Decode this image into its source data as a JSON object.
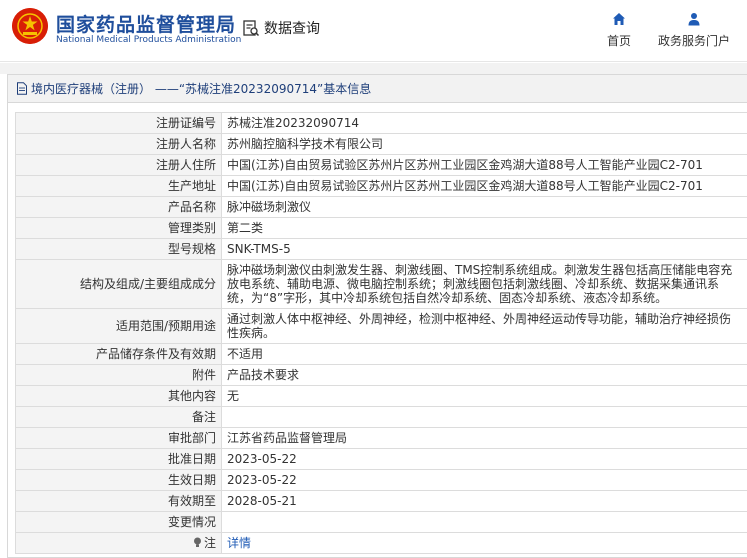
{
  "header": {
    "brand_cn": "国家药品监督管理局",
    "brand_en": "National Medical Products Administration",
    "search_label": "数据查询",
    "nav": [
      {
        "label": "首页",
        "icon": "home-icon"
      },
      {
        "label": "政务服务门户",
        "icon": "user-icon"
      }
    ]
  },
  "panel": {
    "title": "境内医疗器械（注册） ——“苏械注准20232090714”基本信息"
  },
  "rows": [
    {
      "key": "注册证编号",
      "value": "苏械注准20232090714"
    },
    {
      "key": "注册人名称",
      "value": "苏州脑控脑科学技术有限公司"
    },
    {
      "key": "注册人住所",
      "value": "中国(江苏)自由贸易试验区苏州片区苏州工业园区金鸡湖大道88号人工智能产业园C2-701"
    },
    {
      "key": "生产地址",
      "value": "中国(江苏)自由贸易试验区苏州片区苏州工业园区金鸡湖大道88号人工智能产业园C2-701"
    },
    {
      "key": "产品名称",
      "value": "脉冲磁场刺激仪"
    },
    {
      "key": "管理类别",
      "value": "第二类"
    },
    {
      "key": "型号规格",
      "value": "SNK-TMS-5"
    },
    {
      "key": "结构及组成/主要组成成分",
      "value": "脉冲磁场刺激仪由刺激发生器、刺激线圈、TMS控制系统组成。刺激发生器包括高压储能电容充放电系统、辅助电源、微电脑控制系统；刺激线圈包括刺激线圈、冷却系统、数据采集通讯系统，为“8”字形，其中冷却系统包括自然冷却系统、固态冷却系统、液态冷却系统。"
    },
    {
      "key": "适用范围/预期用途",
      "value": "通过刺激人体中枢神经、外周神经，检测中枢神经、外周神经运动传导功能，辅助治疗神经损伤性疾病。"
    },
    {
      "key": "产品储存条件及有效期",
      "value": "不适用"
    },
    {
      "key": "附件",
      "value": "产品技术要求"
    },
    {
      "key": "其他内容",
      "value": "无"
    },
    {
      "key": "备注",
      "value": ""
    },
    {
      "key": "审批部门",
      "value": "江苏省药品监督管理局"
    },
    {
      "key": "批准日期",
      "value": "2023-05-22"
    },
    {
      "key": "生效日期",
      "value": "2023-05-22"
    },
    {
      "key": "有效期至",
      "value": "2028-05-21"
    },
    {
      "key": "变更情况",
      "value": ""
    }
  ],
  "note_row": {
    "key": "注",
    "link": "详情",
    "icon": "bulb-icon"
  },
  "colors": {
    "brand_blue": "#1f4e9c",
    "logo_red": "#d81e06",
    "link_blue": "#1f5bb5"
  }
}
